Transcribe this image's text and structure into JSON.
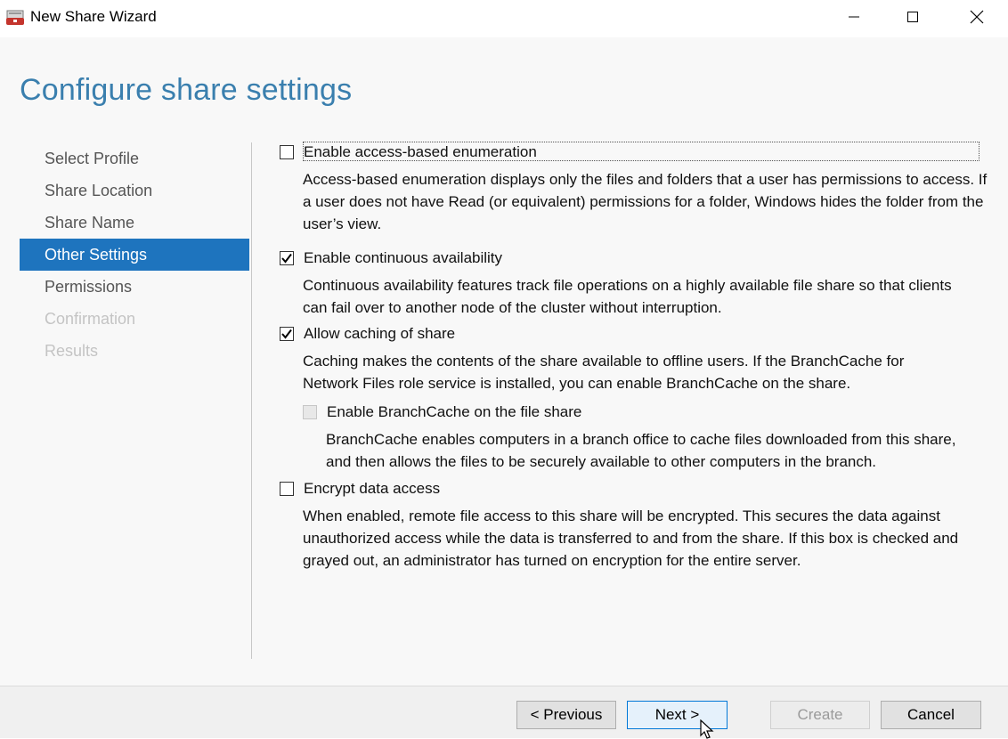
{
  "window": {
    "title": "New Share Wizard",
    "icon": "share-wizard-icon"
  },
  "page": {
    "heading": "Configure share settings"
  },
  "nav": {
    "items": [
      {
        "label": "Select Profile",
        "state": "normal"
      },
      {
        "label": "Share Location",
        "state": "normal"
      },
      {
        "label": "Share Name",
        "state": "normal"
      },
      {
        "label": "Other Settings",
        "state": "active"
      },
      {
        "label": "Permissions",
        "state": "normal"
      },
      {
        "label": "Confirmation",
        "state": "disabled"
      },
      {
        "label": "Results",
        "state": "disabled"
      }
    ]
  },
  "options": {
    "abe": {
      "label": "Enable access-based enumeration",
      "checked": false,
      "description": "Access-based enumeration displays only the files and folders that a user has permissions to access. If a user does not have Read (or equivalent) permissions for a folder, Windows hides the folder from the user’s view."
    },
    "ca": {
      "label": "Enable continuous availability",
      "checked": true,
      "description": "Continuous availability features track file operations on a highly available file share so that clients can fail over to another node of the cluster without interruption."
    },
    "caching": {
      "label": "Allow caching of share",
      "checked": true,
      "description": "Caching makes the contents of the share available to offline users. If the BranchCache for Network Files role service is installed, you can enable BranchCache on the share."
    },
    "branchcache": {
      "label": "Enable BranchCache on the file share",
      "checked": false,
      "disabled": true,
      "description": "BranchCache enables computers in a branch office to cache files downloaded from this share, and then allows the files to be securely available to other computers in the branch."
    },
    "encrypt": {
      "label": "Encrypt data access",
      "checked": false,
      "description": "When enabled, remote file access to this share will be encrypted. This secures the data against unauthorized access while the data is transferred to and from the share. If this box is checked and grayed out, an administrator has turned on encryption for the entire server."
    }
  },
  "buttons": {
    "previous": "< Previous",
    "next": "Next >",
    "create": "Create",
    "cancel": "Cancel"
  },
  "colors": {
    "accent": "#1e74be",
    "heading": "#3a7fae"
  }
}
